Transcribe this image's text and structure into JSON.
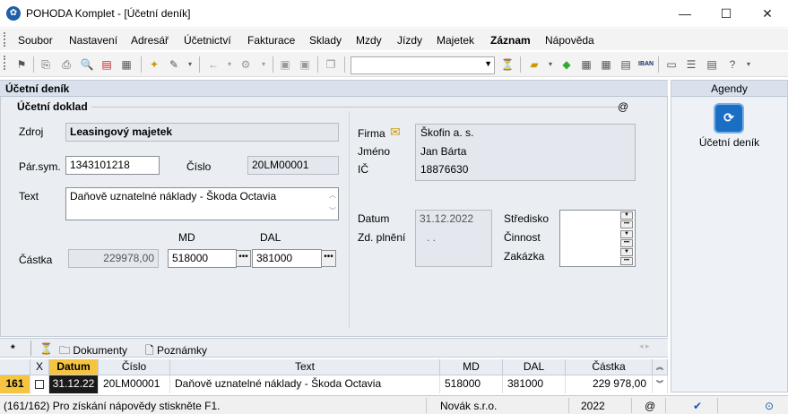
{
  "window": {
    "title": "POHODA Komplet - [Účetní deník]",
    "minimize": "—",
    "maximize": "☐",
    "close": "✕"
  },
  "menu": [
    "Soubor",
    "Nastavení",
    "Adresář",
    "Účetnictví",
    "Fakturace",
    "Sklady",
    "Mzdy",
    "Jízdy",
    "Majetek",
    "Záznam",
    "Nápověda"
  ],
  "panel": {
    "title": "Účetní deník",
    "section": "Účetní doklad",
    "at": "@"
  },
  "form": {
    "zdroj_label": "Zdroj",
    "zdroj": "Leasingový majetek",
    "parsym_label": "Pár.sym.",
    "parsym": "1343101218",
    "cislo_label": "Číslo",
    "cislo": "20LM00001",
    "text_label": "Text",
    "text": "Daňově uznatelné náklady - Škoda Octavia",
    "md_label": "MD",
    "dal_label": "DAL",
    "castka_label": "Částka",
    "castka": "229978,00",
    "md": "518000",
    "dal": "381000",
    "firma_label": "Firma",
    "firma": "Škofin a. s.",
    "jmeno_label": "Jméno",
    "jmeno": "Jan Bárta",
    "ic_label": "IČ",
    "ic": "18876630",
    "datum_label": "Datum",
    "datum": "31.12.2022",
    "zdplneni_label": "Zd. plnění",
    "zdplneni": ". .",
    "stredisko_label": "Středisko",
    "cinnost_label": "Činnost",
    "zakazka_label": "Zakázka"
  },
  "agendy": {
    "title": "Agendy",
    "item": "Účetní deník"
  },
  "tabs": {
    "star": "*",
    "dokumenty": "Dokumenty",
    "poznamky": "Poznámky"
  },
  "grid": {
    "headers": {
      "x": "X",
      "datum": "Datum",
      "cislo": "Číslo",
      "text": "Text",
      "md": "MD",
      "dal": "DAL",
      "castka": "Částka"
    },
    "row": {
      "num": "161",
      "datum": "31.12.22",
      "cislo": "20LM00001",
      "text": "Daňově uznatelné náklady - Škoda Octavia",
      "md": "518000",
      "dal": "381000",
      "castka": "229 978,00"
    }
  },
  "status": {
    "records": "(161/162) Pro získání nápovědy stiskněte F1.",
    "user": "Novák s.r.o.",
    "year": "2022",
    "at": "@"
  }
}
